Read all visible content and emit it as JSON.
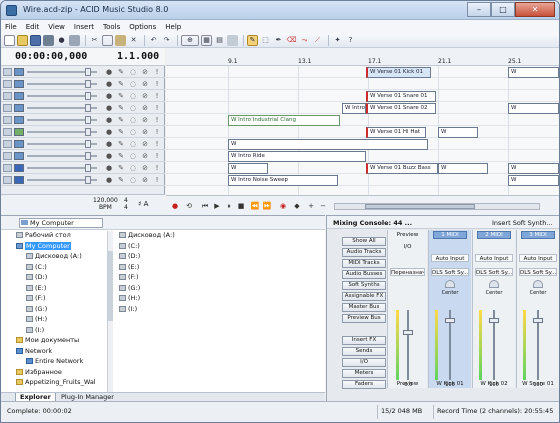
{
  "window": {
    "title": "Wire.acd-zip - ACID Music Studio 8.0",
    "minimize": "–",
    "maximize": "□",
    "close": "✕"
  },
  "menu": [
    "File",
    "Edit",
    "View",
    "Insert",
    "Tools",
    "Options",
    "Help"
  ],
  "time": {
    "position": "00:00:00,000",
    "measure": "1.1.000"
  },
  "tempo": {
    "bpm_value": "120,000",
    "bpm_label": "BPM",
    "sig_top": "4",
    "sig_bottom": "4",
    "key": "A"
  },
  "ruler": [
    "9.1",
    "13.1",
    "17.1",
    "21.1",
    "25.1"
  ],
  "tracks": [
    {
      "color": "#6b95c6"
    },
    {
      "color": "#6b95c6"
    },
    {
      "color": "#6b95c6"
    },
    {
      "color": "#6b95c6"
    },
    {
      "color": "#6b95c6"
    },
    {
      "color": "#74b06a"
    },
    {
      "color": "#6b95c6"
    },
    {
      "color": "#6b95c6"
    },
    {
      "color": "#3b68b8"
    },
    {
      "color": "#3b68b8"
    }
  ],
  "clips": {
    "verse_kick": "W Verse 01 Kick 01",
    "w1": "W",
    "verse_snare1": "W Verse 01 Snare 01",
    "intro": "W Intro",
    "verse_snare2": "W Verse 01 Snare 02",
    "w2": "W",
    "intro_industrial": "W Intro Industrial Clang",
    "verse_hihat": "W Verse 01 Hi Hat",
    "w3": "W",
    "w4": "W",
    "intro_ride": "W Intro Ride",
    "verse_buzz": "W Verse 01 Buzz Bass",
    "w5": "W",
    "w6": "W",
    "w7": "W",
    "intro_noise": "W Intro Noise Sweep",
    "w8": "W"
  },
  "explorer": {
    "path": "My Computer",
    "tree": [
      "Рабочий стол",
      "My Computer",
      "Дисковод (A:)",
      "(C:)",
      "(D:)",
      "(E:)",
      "(F:)",
      "(G:)",
      "(H:)",
      "(I:)",
      "Мои документы",
      "Network",
      "Entire Network",
      "Избранное",
      "Appetizing_Fruits_Wal"
    ],
    "files": [
      "Дисковод (A:)",
      "(C:)",
      "(D:)",
      "(E:)",
      "(F:)",
      "(G:)",
      "(H:)",
      "(I:)"
    ],
    "tabs": [
      "Explorer",
      "Plug-In Manager"
    ]
  },
  "mixer": {
    "title": "Mixing Console: 44 ...",
    "insert": "Insert Soft Synth...",
    "buttons": [
      "Show All",
      "Audio Tracks",
      "MIDI Tracks",
      "Audio Busses",
      "Soft Synths",
      "Assignable FX",
      "Master Bus",
      "Preview Bus",
      "Insert FX",
      "Sends",
      "I/O",
      "Meters",
      "Faders"
    ],
    "preview": {
      "head": "Preview",
      "io": "I/O",
      "label": "Переназначе...",
      "db": "-6.0",
      "foot": "Preview"
    },
    "strips": [
      {
        "badge": "MIDI",
        "num": "1",
        "input": "Auto Input",
        "synth": "DLS Soft Sy...",
        "pan": "Center",
        "vol": "100",
        "foot": "W Kick 01"
      },
      {
        "badge": "MIDI",
        "num": "2",
        "input": "Auto Input",
        "synth": "DLS Soft Sy...",
        "pan": "Center",
        "vol": "100",
        "foot": "W Kick 02"
      },
      {
        "badge": "MIDI",
        "num": "3",
        "input": "Auto Input",
        "synth": "DLS Soft Sy...",
        "pan": "Center",
        "vol": "100",
        "foot": "W Snare 01"
      }
    ],
    "scale": [
      "-Inf",
      "6",
      "12",
      "18",
      "24",
      "30",
      "36",
      "42",
      "48",
      "54"
    ]
  },
  "status": {
    "complete": "Complete: 00:00:02",
    "memory": "15/2 048 MB",
    "record": "Record Time (2 channels): 20:55:45"
  }
}
